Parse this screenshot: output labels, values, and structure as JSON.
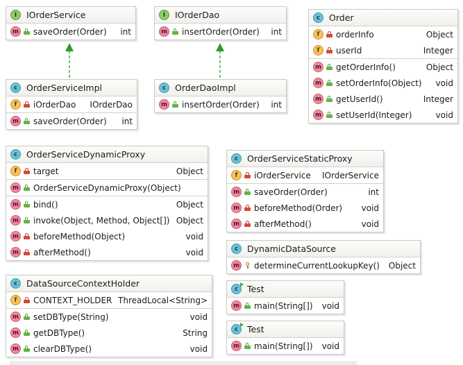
{
  "colors": {
    "class_badge": "#6ec0d8",
    "interface_badge": "#8ccc6a",
    "method_badge": "#ef8aa0",
    "field_badge": "#f5c25e",
    "implements_arrow": "#2e9a2e"
  },
  "classes": [
    {
      "kind": "I",
      "name": "IOrderService",
      "sections": [
        [
          {
            "kind": "m",
            "vis": "pub",
            "name": "saveOrder(Order)",
            "type": "int"
          }
        ]
      ]
    },
    {
      "kind": "I",
      "name": "IOrderDao",
      "sections": [
        [
          {
            "kind": "m",
            "vis": "pub",
            "name": "insertOrder(Order)",
            "type": "int"
          }
        ]
      ]
    },
    {
      "kind": "C",
      "name": "Order",
      "sections": [
        [
          {
            "kind": "f",
            "vis": "pri",
            "name": "orderInfo",
            "type": "Object"
          },
          {
            "kind": "f",
            "vis": "pri",
            "name": "userId",
            "type": "Integer"
          }
        ],
        [
          {
            "kind": "m",
            "vis": "pub",
            "name": "getOrderInfo()",
            "type": "Object"
          },
          {
            "kind": "m",
            "vis": "pub",
            "name": "setOrderInfo(Object)",
            "type": "void"
          },
          {
            "kind": "m",
            "vis": "pub",
            "name": "getUserId()",
            "type": "Integer"
          },
          {
            "kind": "m",
            "vis": "pub",
            "name": "setUserId(Integer)",
            "type": "void"
          }
        ]
      ]
    },
    {
      "kind": "C",
      "name": "OrderServiceImpl",
      "sections": [
        [
          {
            "kind": "f",
            "vis": "pri",
            "name": "iOrderDao",
            "type": "IOrderDao"
          }
        ],
        [
          {
            "kind": "m",
            "vis": "pub",
            "name": "saveOrder(Order)",
            "type": "int"
          }
        ]
      ]
    },
    {
      "kind": "C",
      "name": "OrderDaoImpl",
      "sections": [
        [
          {
            "kind": "m",
            "vis": "pub",
            "name": "insertOrder(Order)",
            "type": "int"
          }
        ]
      ]
    },
    {
      "kind": "C",
      "name": "OrderServiceDynamicProxy",
      "sections": [
        [
          {
            "kind": "f",
            "vis": "pri",
            "name": "target",
            "type": "Object"
          }
        ],
        [
          {
            "kind": "m",
            "vis": "pub",
            "name": "OrderServiceDynamicProxy(Object)",
            "type": ""
          }
        ],
        [
          {
            "kind": "m",
            "vis": "pub",
            "name": "bind()",
            "type": "Object"
          },
          {
            "kind": "m",
            "vis": "pub",
            "name": "invoke(Object, Method, Object[])",
            "type": "Object"
          },
          {
            "kind": "m",
            "vis": "pri",
            "name": "beforeMethod(Object)",
            "type": "void"
          },
          {
            "kind": "m",
            "vis": "pri",
            "name": "afterMethod()",
            "type": "void"
          }
        ]
      ]
    },
    {
      "kind": "C",
      "name": "OrderServiceStaticProxy",
      "sections": [
        [
          {
            "kind": "f",
            "vis": "pri",
            "name": "iOrderService",
            "type": "IOrderService"
          }
        ],
        [
          {
            "kind": "m",
            "vis": "pub",
            "name": "saveOrder(Order)",
            "type": "int"
          },
          {
            "kind": "m",
            "vis": "pri",
            "name": "beforeMethod(Order)",
            "type": "void"
          },
          {
            "kind": "m",
            "vis": "pri",
            "name": "afterMethod()",
            "type": "void"
          }
        ]
      ]
    },
    {
      "kind": "C",
      "name": "DynamicDataSource",
      "sections": [
        [
          {
            "kind": "m",
            "vis": "prot",
            "name": "determineCurrentLookupKey()",
            "type": "Object"
          }
        ]
      ]
    },
    {
      "kind": "C",
      "name": "DataSourceContextHolder",
      "sections": [
        [
          {
            "kind": "f",
            "vis": "pri",
            "name": "CONTEXT_HOLDER",
            "type": "ThreadLocal<String>"
          }
        ],
        [
          {
            "kind": "m",
            "vis": "pub",
            "name": "setDBType(String)",
            "type": "void"
          },
          {
            "kind": "m",
            "vis": "pub",
            "name": "getDBType()",
            "type": "String"
          },
          {
            "kind": "m",
            "vis": "pub",
            "name": "clearDBType()",
            "type": "void"
          }
        ]
      ]
    },
    {
      "kind": "CR",
      "name": "Test",
      "sections": [
        [
          {
            "kind": "m",
            "vis": "pub",
            "name": "main(String[])",
            "type": "void"
          }
        ]
      ]
    },
    {
      "kind": "CR",
      "name": "Test",
      "sections": [
        [
          {
            "kind": "m",
            "vis": "pub",
            "name": "main(String[])",
            "type": "void"
          }
        ]
      ]
    }
  ]
}
